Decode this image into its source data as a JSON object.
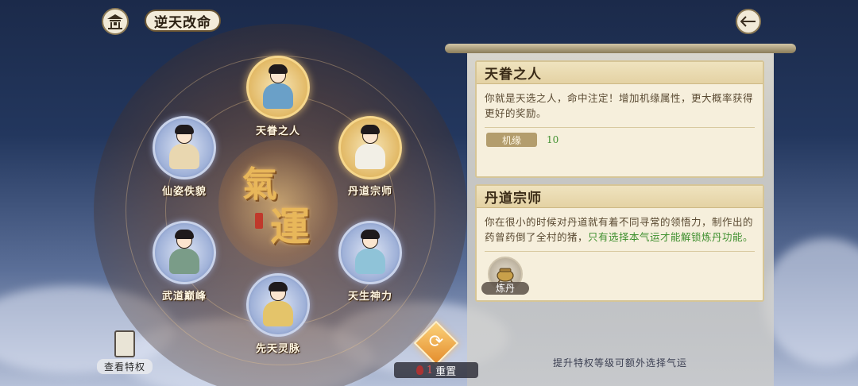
{
  "header": {
    "title": "逆天改命",
    "home_icon": "pavilion-icon",
    "back_icon": "back-arrow-icon"
  },
  "wheel": {
    "center_chars": [
      "氣",
      "運"
    ],
    "nodes": [
      {
        "id": "tianjuan",
        "label": "天眷之人",
        "selected": true
      },
      {
        "id": "xianzi",
        "label": "仙姿佚貌",
        "selected": false
      },
      {
        "id": "dandao",
        "label": "丹道宗师",
        "selected": true
      },
      {
        "id": "wudao",
        "label": "武道巅峰",
        "selected": false
      },
      {
        "id": "tiansheng",
        "label": "天生神力",
        "selected": false
      },
      {
        "id": "xiantian",
        "label": "先天灵脉",
        "selected": false
      }
    ]
  },
  "cards": [
    {
      "title": "天眷之人",
      "desc": "你就是天选之人，命中注定！增加机缘属性，更大概率获得更好的奖励。",
      "attr_name": "机缘",
      "attr_value": "10"
    },
    {
      "title": "丹道宗师",
      "desc_plain": "你在很小的时候对丹道就有着不同寻常的领悟力，制作出的药曾药倒了全村的猪，",
      "desc_highlight": "只有选择本气运才能解锁炼丹功能。",
      "unlock_label": "炼丹",
      "unlock_icon": "alchemy-cauldron-icon"
    }
  ],
  "hint": "提升特权等级可额外选择气运",
  "privilege": {
    "label": "查看特权",
    "icon": "scroll-badge-icon"
  },
  "reset": {
    "label": "重置",
    "cost": "1",
    "icon": "refresh-icon",
    "cost_icon": "gourd-icon"
  },
  "colors": {
    "gold": "#e2b966",
    "highlight_green": "#3e8f2e",
    "card_bg": "#f6efdc"
  }
}
